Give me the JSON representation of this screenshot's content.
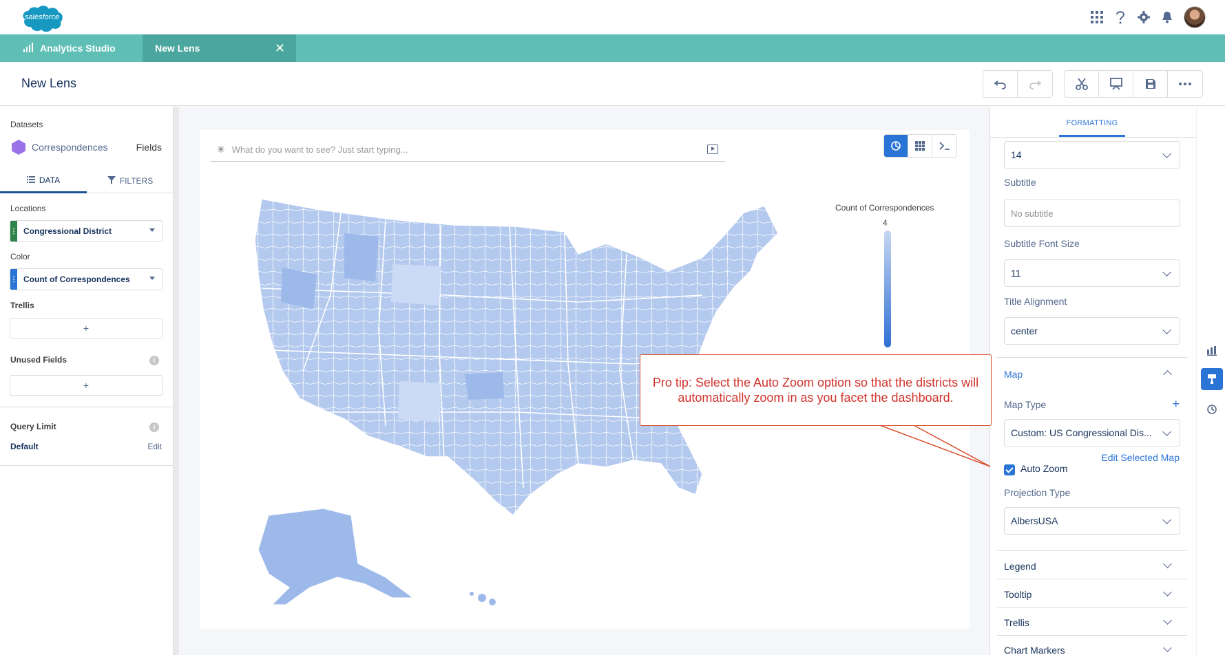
{
  "header": {
    "logo_text": "salesforce",
    "icons": [
      "app-launcher-icon",
      "help-icon",
      "gear-icon",
      "bell-icon"
    ]
  },
  "tabs": {
    "app_tab": "Analytics Studio",
    "lens_tab": "New Lens",
    "close_symbol": "✕"
  },
  "page": {
    "title": "New Lens"
  },
  "left_panel": {
    "datasets_label": "Datasets",
    "dataset_name": "Correspondences",
    "fields_link": "Fields",
    "tabs": {
      "data": "DATA",
      "filters": "FILTERS"
    },
    "locations_label": "Locations",
    "location_field": "Congressional District",
    "color_label": "Color",
    "color_field": "Count of Correspondences",
    "trellis_label": "Trellis",
    "add_symbol": "+",
    "unused_fields_label": "Unused Fields",
    "query_limit_label": "Query Limit",
    "query_limit_value": "Default",
    "edit_link": "Edit",
    "info_symbol": "i"
  },
  "canvas": {
    "search_placeholder": "What do you want to see? Just start typing...",
    "legend_title": "Count of Correspondences",
    "legend_max": "4",
    "callout": "Pro tip: Select the Auto Zoom option so that the districts will automatically zoom in as you facet the dashboard."
  },
  "right_panel": {
    "tab": "FORMATTING",
    "title_font_size": "14",
    "subtitle_label": "Subtitle",
    "subtitle_placeholder": "No subtitle",
    "subtitle_font_size_label": "Subtitle Font Size",
    "subtitle_font_size": "11",
    "title_alignment_label": "Title Alignment",
    "title_alignment": "center",
    "map_section": "Map",
    "map_type_label": "Map Type",
    "map_type_add": "+",
    "map_type": "Custom: US Congressional Dis...",
    "edit_map_link": "Edit Selected Map",
    "auto_zoom_label": "Auto Zoom",
    "auto_zoom_checked": true,
    "projection_label": "Projection Type",
    "projection": "AlbersUSA",
    "sections": [
      "Legend",
      "Tooltip",
      "Trellis",
      "Chart Markers"
    ]
  },
  "colors": {
    "tab_bar": "#5fbfb7",
    "accent": "#2a74d5",
    "callout": "#d0342c",
    "map_fill": "#b3c9ee"
  }
}
